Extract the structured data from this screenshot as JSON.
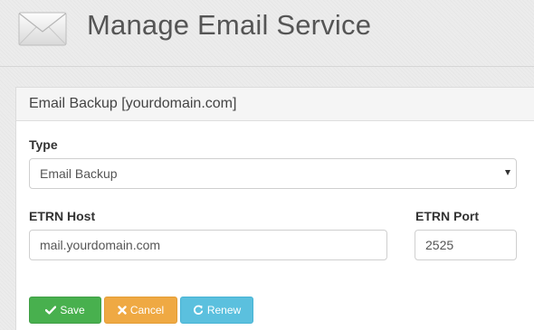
{
  "header": {
    "title": "Manage Email Service",
    "icon": "envelope-icon"
  },
  "panel": {
    "heading": "Email Backup [yourdomain.com]",
    "type": {
      "label": "Type",
      "selected": "Email Backup"
    },
    "etrn_host": {
      "label": "ETRN Host",
      "value": "mail.yourdomain.com"
    },
    "etrn_port": {
      "label": "ETRN Port",
      "value": "2525"
    },
    "buttons": {
      "save": {
        "label": "Save",
        "icon": "check-icon",
        "color": "#48b04e"
      },
      "cancel": {
        "label": "Cancel",
        "icon": "close-icon",
        "color": "#efa943"
      },
      "renew": {
        "label": "Renew",
        "icon": "refresh-icon",
        "color": "#5bc0de"
      }
    }
  }
}
